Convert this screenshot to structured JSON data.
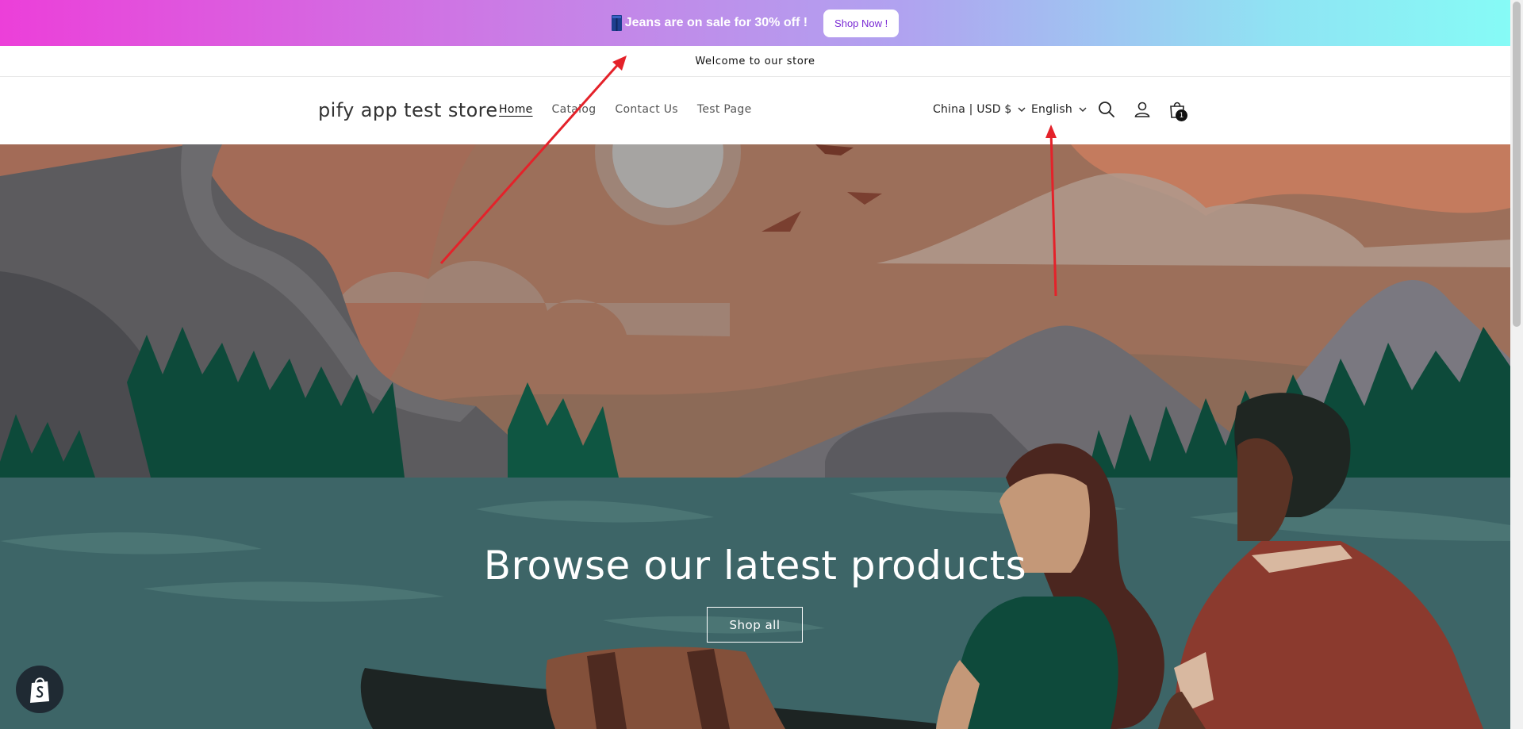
{
  "promo": {
    "text": "Jeans are on sale for 30% off !",
    "button_label": "Shop Now !",
    "icon": "jeans-icon",
    "gradient": [
      "#ec3fd9",
      "#c97ee6",
      "#b0a3f0",
      "#86fbf6"
    ]
  },
  "announcement": {
    "text": "Welcome to our store"
  },
  "header": {
    "logo": "pify app test store",
    "nav": [
      {
        "label": "Home",
        "active": true
      },
      {
        "label": "Catalog",
        "active": false
      },
      {
        "label": "Contact Us",
        "active": false
      },
      {
        "label": "Test Page",
        "active": false
      }
    ],
    "country_selector": "China | USD $",
    "language_selector": "English",
    "icons": [
      "search-icon",
      "account-icon",
      "cart-icon"
    ],
    "cart_count": "1"
  },
  "hero": {
    "heading": "Browse our latest products",
    "button_label": "Shop all"
  },
  "colors": {
    "promo_button_text": "#7a2bd4",
    "annotation_arrow": "#e4222a",
    "lake": "#3d6567",
    "tree": "#0d4a3a"
  }
}
